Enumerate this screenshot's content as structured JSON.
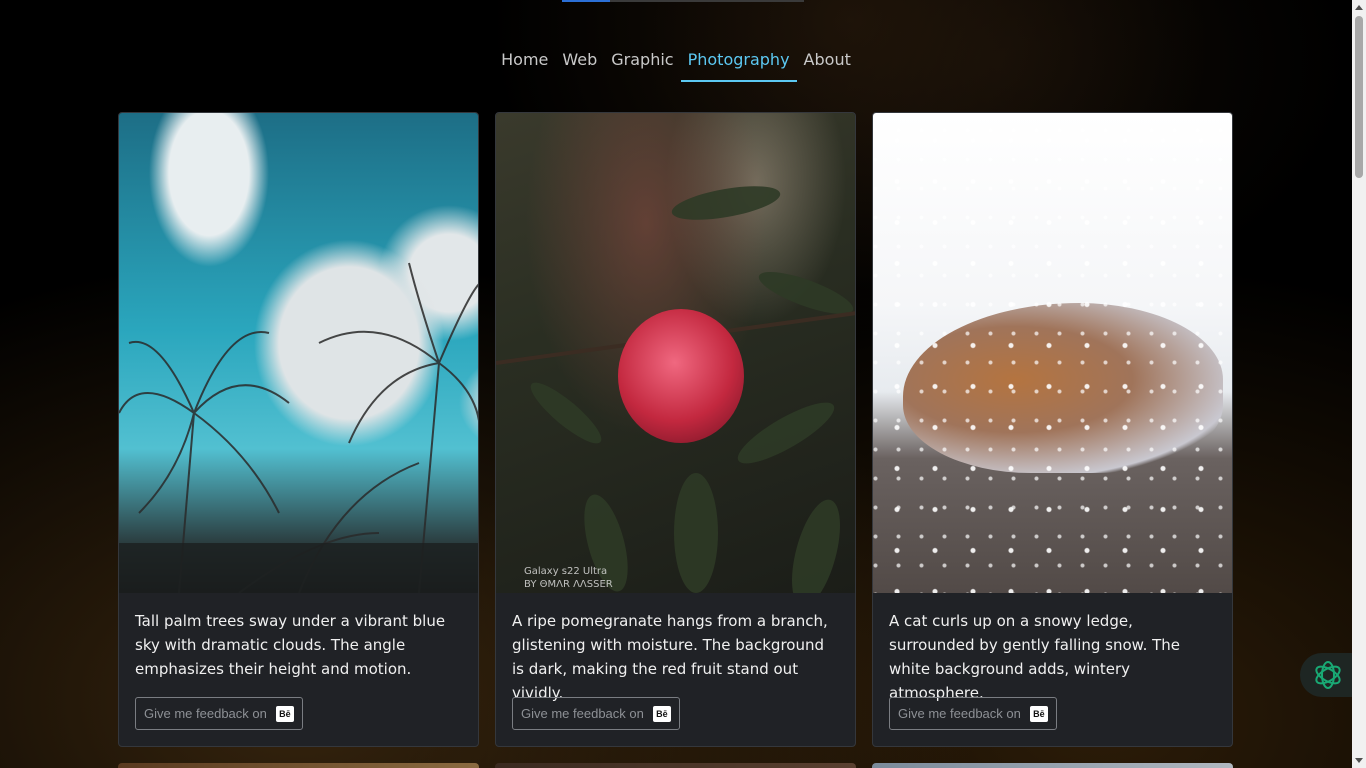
{
  "nav": {
    "items": [
      {
        "label": "Home"
      },
      {
        "label": "Web"
      },
      {
        "label": "Graphic"
      },
      {
        "label": "Photography"
      },
      {
        "label": "About"
      }
    ],
    "active": "Photography"
  },
  "cards": [
    {
      "caption": "Tall palm trees sway under a vibrant blue sky with dramatic clouds. The angle emphasizes their height and motion.",
      "feedback_label": "Give me feedback on",
      "feedback_icon": "behance-icon"
    },
    {
      "caption": "A ripe pomegranate hangs from a branch, glistening with moisture. The background is dark, making the red fruit stand out vividly.",
      "feedback_label": "Give me feedback on",
      "feedback_icon": "behance-icon",
      "watermark_line1": "Galaxy s22 Ultra",
      "watermark_line2": "BY ΘMΛR ΛΛSSER"
    },
    {
      "caption": "A cat curls up on a snowy ledge, surrounded by gently falling snow. The white background adds, wintery atmosphere.",
      "feedback_label": "Give me feedback on",
      "feedback_icon": "behance-icon"
    }
  ],
  "behance_glyph": "Bē",
  "colors": {
    "accent": "#5cc8f2",
    "card_bg": "#202226",
    "page_bg": "#000000",
    "fab_icon": "#19a974"
  },
  "top_progress": 0.2
}
